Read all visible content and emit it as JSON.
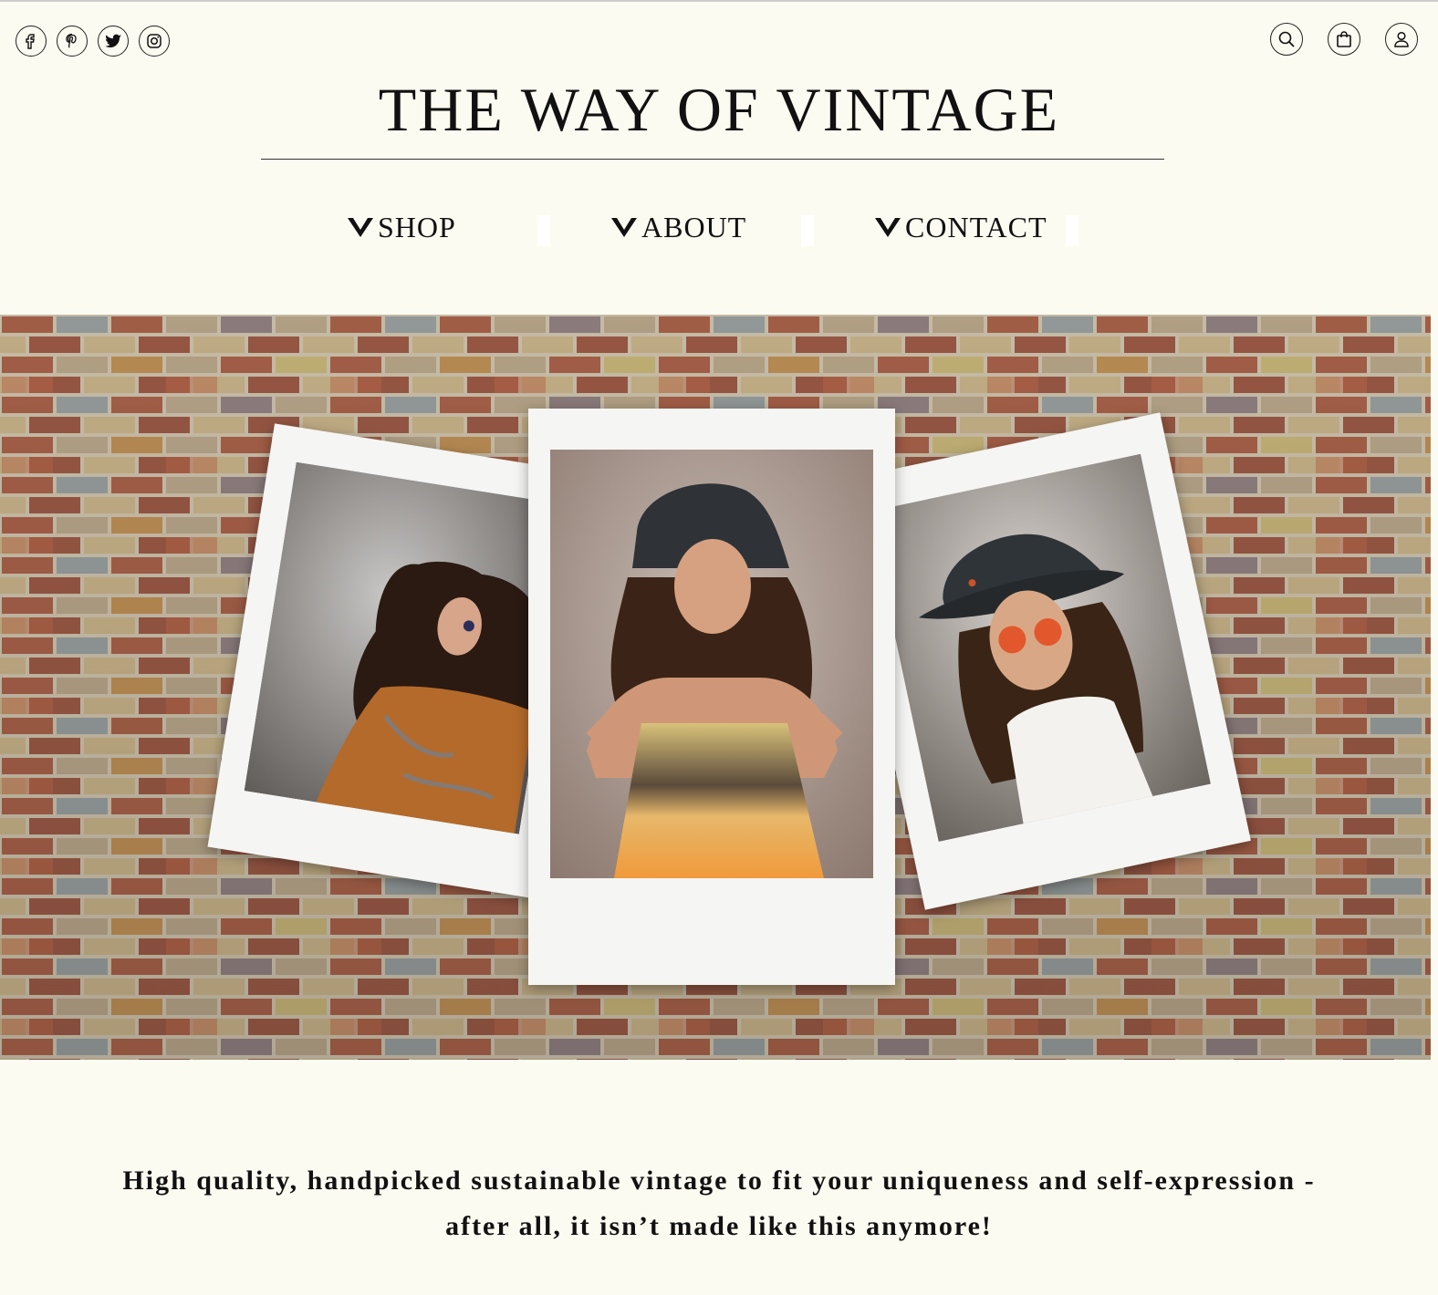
{
  "brand": {
    "title": "THE WAY OF VINTAGE"
  },
  "social_icons": [
    "facebook-icon",
    "pinterest-icon",
    "twitter-icon",
    "instagram-icon"
  ],
  "utility_icons": [
    "search-icon",
    "shopping-bag-icon",
    "user-account-icon"
  ],
  "nav": {
    "items": [
      {
        "label": "SHOP",
        "icon": "chevron-down-icon"
      },
      {
        "label": "ABOUT",
        "icon": "chevron-down-icon"
      },
      {
        "label": "CONTACT",
        "icon": "chevron-down-icon"
      }
    ]
  },
  "hero": {
    "photos": [
      "paisley-dress-photo",
      "tie-dye-dress-photo",
      "bucket-hat-photo"
    ]
  },
  "tagline": {
    "line1": "High quality, handpicked sustainable vintage to fit your uniqueness and self-expression -",
    "line2": "after all, it isn’t made like this anymore!"
  },
  "colors": {
    "background": "#fcfbf1",
    "text": "#111111",
    "polaroid_frame": "#f5f5f3"
  }
}
